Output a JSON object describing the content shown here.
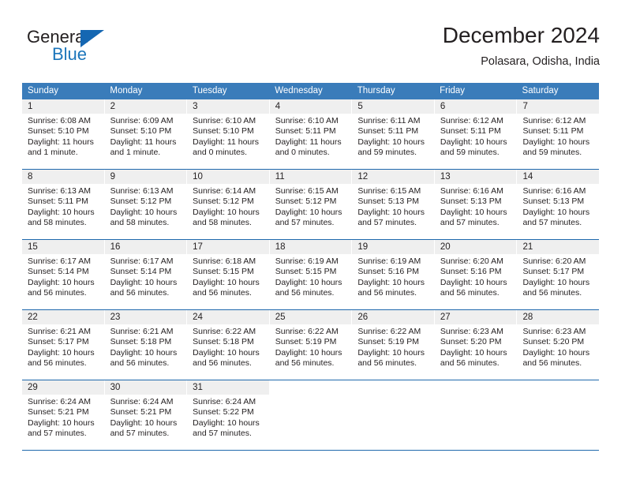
{
  "brand": {
    "name_top": "General",
    "name_bottom": "Blue",
    "accent_color": "#1b75bb",
    "triangle_icon": "triangle-icon"
  },
  "header": {
    "title": "December 2024",
    "subtitle": "Polasara, Odisha, India"
  },
  "theme": {
    "header_bar": "#3a7cba",
    "week_divider": "#1f69ad",
    "daynum_band": "#efefef",
    "text": "#231f20"
  },
  "calendar": {
    "weekday_headers": [
      "Sunday",
      "Monday",
      "Tuesday",
      "Wednesday",
      "Thursday",
      "Friday",
      "Saturday"
    ],
    "weeks": [
      [
        {
          "day": "1",
          "sunrise": "Sunrise: 6:08 AM",
          "sunset": "Sunset: 5:10 PM",
          "daylight1": "Daylight: 11 hours",
          "daylight2": "and 1 minute."
        },
        {
          "day": "2",
          "sunrise": "Sunrise: 6:09 AM",
          "sunset": "Sunset: 5:10 PM",
          "daylight1": "Daylight: 11 hours",
          "daylight2": "and 1 minute."
        },
        {
          "day": "3",
          "sunrise": "Sunrise: 6:10 AM",
          "sunset": "Sunset: 5:10 PM",
          "daylight1": "Daylight: 11 hours",
          "daylight2": "and 0 minutes."
        },
        {
          "day": "4",
          "sunrise": "Sunrise: 6:10 AM",
          "sunset": "Sunset: 5:11 PM",
          "daylight1": "Daylight: 11 hours",
          "daylight2": "and 0 minutes."
        },
        {
          "day": "5",
          "sunrise": "Sunrise: 6:11 AM",
          "sunset": "Sunset: 5:11 PM",
          "daylight1": "Daylight: 10 hours",
          "daylight2": "and 59 minutes."
        },
        {
          "day": "6",
          "sunrise": "Sunrise: 6:12 AM",
          "sunset": "Sunset: 5:11 PM",
          "daylight1": "Daylight: 10 hours",
          "daylight2": "and 59 minutes."
        },
        {
          "day": "7",
          "sunrise": "Sunrise: 6:12 AM",
          "sunset": "Sunset: 5:11 PM",
          "daylight1": "Daylight: 10 hours",
          "daylight2": "and 59 minutes."
        }
      ],
      [
        {
          "day": "8",
          "sunrise": "Sunrise: 6:13 AM",
          "sunset": "Sunset: 5:11 PM",
          "daylight1": "Daylight: 10 hours",
          "daylight2": "and 58 minutes."
        },
        {
          "day": "9",
          "sunrise": "Sunrise: 6:13 AM",
          "sunset": "Sunset: 5:12 PM",
          "daylight1": "Daylight: 10 hours",
          "daylight2": "and 58 minutes."
        },
        {
          "day": "10",
          "sunrise": "Sunrise: 6:14 AM",
          "sunset": "Sunset: 5:12 PM",
          "daylight1": "Daylight: 10 hours",
          "daylight2": "and 58 minutes."
        },
        {
          "day": "11",
          "sunrise": "Sunrise: 6:15 AM",
          "sunset": "Sunset: 5:12 PM",
          "daylight1": "Daylight: 10 hours",
          "daylight2": "and 57 minutes."
        },
        {
          "day": "12",
          "sunrise": "Sunrise: 6:15 AM",
          "sunset": "Sunset: 5:13 PM",
          "daylight1": "Daylight: 10 hours",
          "daylight2": "and 57 minutes."
        },
        {
          "day": "13",
          "sunrise": "Sunrise: 6:16 AM",
          "sunset": "Sunset: 5:13 PM",
          "daylight1": "Daylight: 10 hours",
          "daylight2": "and 57 minutes."
        },
        {
          "day": "14",
          "sunrise": "Sunrise: 6:16 AM",
          "sunset": "Sunset: 5:13 PM",
          "daylight1": "Daylight: 10 hours",
          "daylight2": "and 57 minutes."
        }
      ],
      [
        {
          "day": "15",
          "sunrise": "Sunrise: 6:17 AM",
          "sunset": "Sunset: 5:14 PM",
          "daylight1": "Daylight: 10 hours",
          "daylight2": "and 56 minutes."
        },
        {
          "day": "16",
          "sunrise": "Sunrise: 6:17 AM",
          "sunset": "Sunset: 5:14 PM",
          "daylight1": "Daylight: 10 hours",
          "daylight2": "and 56 minutes."
        },
        {
          "day": "17",
          "sunrise": "Sunrise: 6:18 AM",
          "sunset": "Sunset: 5:15 PM",
          "daylight1": "Daylight: 10 hours",
          "daylight2": "and 56 minutes."
        },
        {
          "day": "18",
          "sunrise": "Sunrise: 6:19 AM",
          "sunset": "Sunset: 5:15 PM",
          "daylight1": "Daylight: 10 hours",
          "daylight2": "and 56 minutes."
        },
        {
          "day": "19",
          "sunrise": "Sunrise: 6:19 AM",
          "sunset": "Sunset: 5:16 PM",
          "daylight1": "Daylight: 10 hours",
          "daylight2": "and 56 minutes."
        },
        {
          "day": "20",
          "sunrise": "Sunrise: 6:20 AM",
          "sunset": "Sunset: 5:16 PM",
          "daylight1": "Daylight: 10 hours",
          "daylight2": "and 56 minutes."
        },
        {
          "day": "21",
          "sunrise": "Sunrise: 6:20 AM",
          "sunset": "Sunset: 5:17 PM",
          "daylight1": "Daylight: 10 hours",
          "daylight2": "and 56 minutes."
        }
      ],
      [
        {
          "day": "22",
          "sunrise": "Sunrise: 6:21 AM",
          "sunset": "Sunset: 5:17 PM",
          "daylight1": "Daylight: 10 hours",
          "daylight2": "and 56 minutes."
        },
        {
          "day": "23",
          "sunrise": "Sunrise: 6:21 AM",
          "sunset": "Sunset: 5:18 PM",
          "daylight1": "Daylight: 10 hours",
          "daylight2": "and 56 minutes."
        },
        {
          "day": "24",
          "sunrise": "Sunrise: 6:22 AM",
          "sunset": "Sunset: 5:18 PM",
          "daylight1": "Daylight: 10 hours",
          "daylight2": "and 56 minutes."
        },
        {
          "day": "25",
          "sunrise": "Sunrise: 6:22 AM",
          "sunset": "Sunset: 5:19 PM",
          "daylight1": "Daylight: 10 hours",
          "daylight2": "and 56 minutes."
        },
        {
          "day": "26",
          "sunrise": "Sunrise: 6:22 AM",
          "sunset": "Sunset: 5:19 PM",
          "daylight1": "Daylight: 10 hours",
          "daylight2": "and 56 minutes."
        },
        {
          "day": "27",
          "sunrise": "Sunrise: 6:23 AM",
          "sunset": "Sunset: 5:20 PM",
          "daylight1": "Daylight: 10 hours",
          "daylight2": "and 56 minutes."
        },
        {
          "day": "28",
          "sunrise": "Sunrise: 6:23 AM",
          "sunset": "Sunset: 5:20 PM",
          "daylight1": "Daylight: 10 hours",
          "daylight2": "and 56 minutes."
        }
      ],
      [
        {
          "day": "29",
          "sunrise": "Sunrise: 6:24 AM",
          "sunset": "Sunset: 5:21 PM",
          "daylight1": "Daylight: 10 hours",
          "daylight2": "and 57 minutes."
        },
        {
          "day": "30",
          "sunrise": "Sunrise: 6:24 AM",
          "sunset": "Sunset: 5:21 PM",
          "daylight1": "Daylight: 10 hours",
          "daylight2": "and 57 minutes."
        },
        {
          "day": "31",
          "sunrise": "Sunrise: 6:24 AM",
          "sunset": "Sunset: 5:22 PM",
          "daylight1": "Daylight: 10 hours",
          "daylight2": "and 57 minutes."
        },
        {
          "day": "",
          "sunrise": "",
          "sunset": "",
          "daylight1": "",
          "daylight2": ""
        },
        {
          "day": "",
          "sunrise": "",
          "sunset": "",
          "daylight1": "",
          "daylight2": ""
        },
        {
          "day": "",
          "sunrise": "",
          "sunset": "",
          "daylight1": "",
          "daylight2": ""
        },
        {
          "day": "",
          "sunrise": "",
          "sunset": "",
          "daylight1": "",
          "daylight2": ""
        }
      ]
    ]
  }
}
